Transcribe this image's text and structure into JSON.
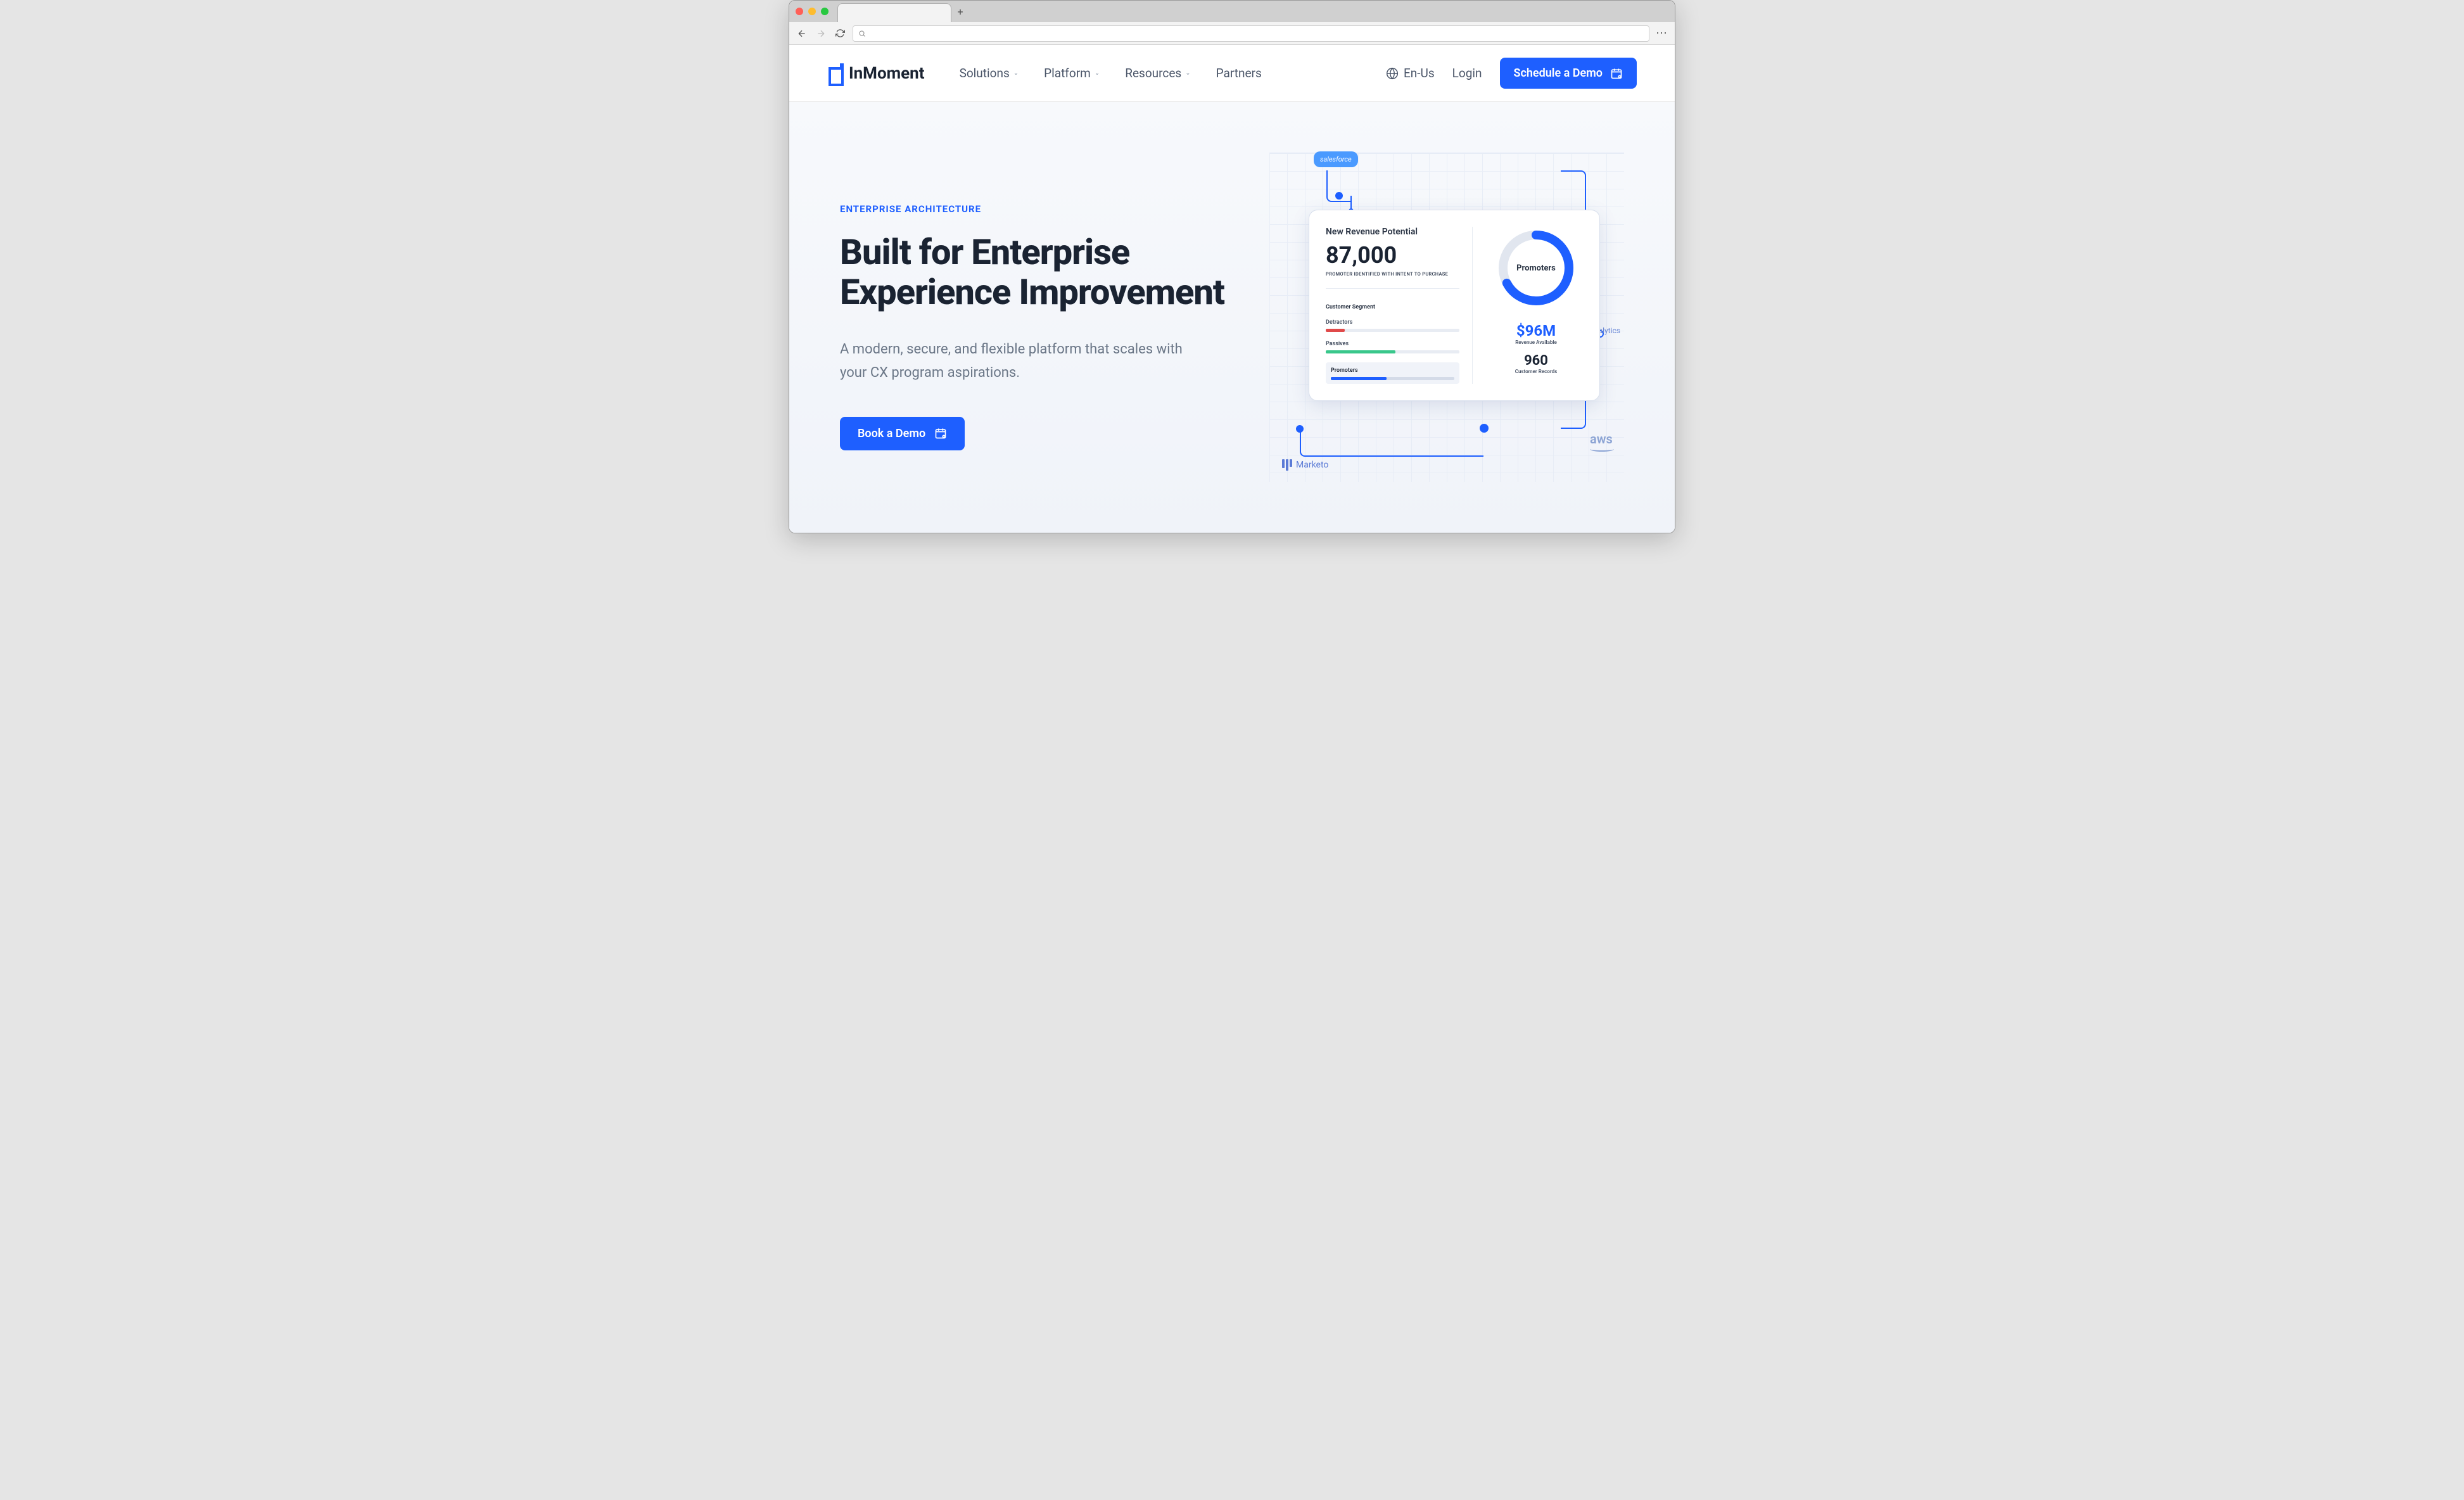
{
  "browser": {
    "url_placeholder": ""
  },
  "header": {
    "brand": "InMoment",
    "nav": [
      "Solutions",
      "Platform",
      "Resources",
      "Partners"
    ],
    "locale": "En-Us",
    "login": "Login",
    "schedule_btn": "Schedule a Demo"
  },
  "hero": {
    "eyebrow": "ENTERPRISE ARCHITECTURE",
    "headline": "Built for Enterprise Experience Improvement",
    "subhead": "A modern, secure, and flexible platform that scales with your CX program aspirations.",
    "book_btn": "Book a Demo"
  },
  "illustration": {
    "badges": {
      "salesforce": "salesforce",
      "marketo": "Marketo",
      "aws": "aws",
      "ga": "Google Analytics"
    },
    "dashboard": {
      "revenue_title": "New Revenue Potential",
      "revenue_value": "87,000",
      "revenue_sub": "PROMOTER IDENTIFIED WITH INTENT TO PURCHASE",
      "segment_title": "Customer Segment",
      "segments": {
        "detractors": "Detractors",
        "passives": "Passives",
        "promoters": "Promoters"
      },
      "donut_label": "Promoters",
      "metric1_value": "$96M",
      "metric1_label": "Revenue Available",
      "metric2_value": "960",
      "metric2_label": "Customer Records"
    }
  }
}
